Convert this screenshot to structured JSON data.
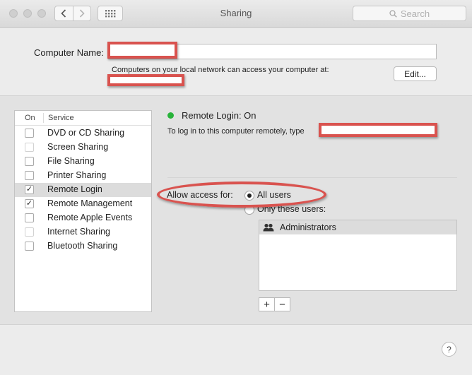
{
  "window": {
    "title": "Sharing",
    "search_placeholder": "Search"
  },
  "computer_name": {
    "label": "Computer Name:",
    "value": "",
    "access_info": "Computers on your local network can access your computer at:",
    "edit_label": "Edit..."
  },
  "services": {
    "header_on": "On",
    "header_service": "Service",
    "items": [
      {
        "label": "DVD or CD Sharing",
        "checked": false,
        "selected": false
      },
      {
        "label": "Screen Sharing",
        "checked": false,
        "selected": false
      },
      {
        "label": "File Sharing",
        "checked": false,
        "selected": false
      },
      {
        "label": "Printer Sharing",
        "checked": false,
        "selected": false
      },
      {
        "label": "Remote Login",
        "checked": true,
        "selected": true
      },
      {
        "label": "Remote Management",
        "checked": true,
        "selected": false
      },
      {
        "label": "Remote Apple Events",
        "checked": false,
        "selected": false
      },
      {
        "label": "Internet Sharing",
        "checked": false,
        "selected": false
      },
      {
        "label": "Bluetooth Sharing",
        "checked": false,
        "selected": false
      }
    ]
  },
  "detail": {
    "status": "Remote Login: On",
    "status_color": "#28b33a",
    "login_hint": "To log in to this computer remotely, type",
    "allow_label": "Allow access for:",
    "option_all": "All users",
    "option_only": "Only these users:",
    "selected_option": "all",
    "users": [
      "Administrators"
    ],
    "add_label": "+",
    "remove_label": "−"
  },
  "help_label": "?",
  "colors": {
    "annotation_red": "#d9534f"
  }
}
